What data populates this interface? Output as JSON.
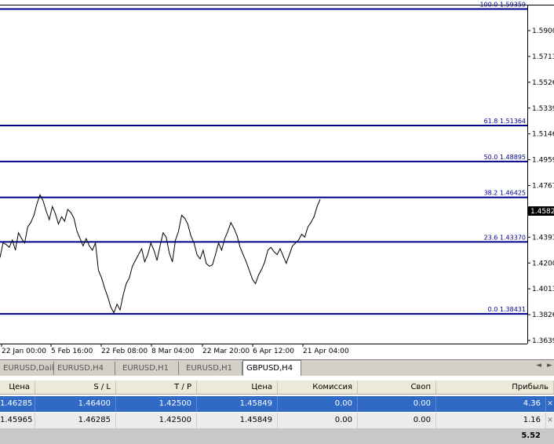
{
  "chart": {
    "price_axis_ticks": [
      "1.5900",
      "1.5713",
      "1.5526",
      "1.5339",
      "1.5146",
      "1.4959",
      "1.4767",
      "1.4582",
      "1.4393",
      "1.4200",
      "1.4013",
      "1.3826",
      "1.3639"
    ],
    "current_price_label": "1.4582",
    "time_axis_labels": [
      "22 Jan 00:00",
      "5 Feb 16:00",
      "22 Feb 08:00",
      "8 Mar 04:00",
      "22 Mar 20:00",
      "6 Apr 12:00",
      "21 Apr 04:00"
    ],
    "fibo_levels": [
      {
        "label": "100.0 1.59359",
        "price": 1.59359
      },
      {
        "label": "61.8 1.51364",
        "price": 1.51364
      },
      {
        "label": "50.0 1.48895",
        "price": 1.48895
      },
      {
        "label": "38.2 1.46425",
        "price": 1.46425
      },
      {
        "label": "23.6 1.43370",
        "price": 1.4337
      },
      {
        "label": "0.0 1.38431",
        "price": 1.38431
      }
    ],
    "line_color": "#00008b",
    "price_series": [
      1.423,
      1.433,
      1.432,
      1.43,
      1.435,
      1.428,
      1.44,
      1.436,
      1.433,
      1.444,
      1.447,
      1.452,
      1.46,
      1.466,
      1.462,
      1.455,
      1.449,
      1.458,
      1.453,
      1.446,
      1.451,
      1.448,
      1.456,
      1.454,
      1.45,
      1.441,
      1.436,
      1.431,
      1.436,
      1.431,
      1.428,
      1.433,
      1.414,
      1.409,
      1.402,
      1.396,
      1.389,
      1.385,
      1.391,
      1.387,
      1.397,
      1.405,
      1.409,
      1.417,
      1.421,
      1.425,
      1.429,
      1.42,
      1.425,
      1.433,
      1.428,
      1.421,
      1.431,
      1.44,
      1.437,
      1.426,
      1.42,
      1.435,
      1.441,
      1.452,
      1.45,
      1.446,
      1.438,
      1.433,
      1.425,
      1.422,
      1.428,
      1.419,
      1.417,
      1.418,
      1.425,
      1.433,
      1.428,
      1.436,
      1.441,
      1.447,
      1.443,
      1.438,
      1.43,
      1.425,
      1.42,
      1.414,
      1.408,
      1.405,
      1.411,
      1.415,
      1.42,
      1.428,
      1.43,
      1.427,
      1.425,
      1.429,
      1.424,
      1.419,
      1.425,
      1.431,
      1.433,
      1.435,
      1.439,
      1.437,
      1.444,
      1.447,
      1.451,
      1.458,
      1.463
    ],
    "price_min": 1.3639,
    "price_max": 1.5955
  },
  "tabs": [
    {
      "label": "EURUSD,Daily"
    },
    {
      "label": "EURUSD,H4"
    },
    {
      "label": "EURUSD,H1"
    },
    {
      "label": "EURUSD,H1"
    },
    {
      "label": "GBPUSD,H4"
    }
  ],
  "nav": {
    "prev": "◄",
    "next": "►"
  },
  "terminal": {
    "headers": {
      "price": "Цена",
      "sl": "S / L",
      "tp": "T / P",
      "cur_price": "Цена",
      "commission": "Комиссия",
      "swap": "Своп",
      "profit": "Прибыль"
    },
    "rows": [
      {
        "price": "1.46285",
        "sl": "1.46400",
        "tp": "1.42500",
        "cur_price": "1.45849",
        "commission": "0.00",
        "swap": "0.00",
        "profit": "4.36"
      },
      {
        "price": "1.45965",
        "sl": "1.46285",
        "tp": "1.42500",
        "cur_price": "1.45849",
        "commission": "0.00",
        "swap": "0.00",
        "profit": "1.16"
      }
    ],
    "total": "5.52",
    "close_symbol": "✕"
  },
  "colors": {
    "selected_row": "#316ac5",
    "fibo_line": "#00008b"
  }
}
